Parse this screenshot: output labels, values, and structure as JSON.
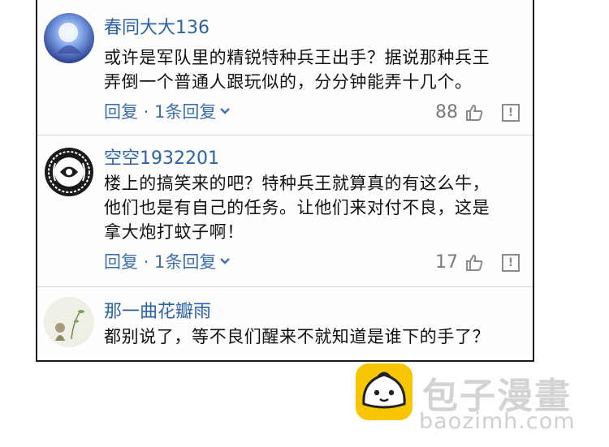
{
  "comments": [
    {
      "user": "春同大大136",
      "text_lines": [
        "或许是军队里的精锐特种兵王出手？据说那种兵王",
        "弄倒一个普通人跟玩似的，分分钟能弄十几个。"
      ],
      "reply_label": "回复 · 1条回复",
      "likes": "88"
    },
    {
      "user": "空空1932201",
      "text_lines": [
        "楼上的搞笑来的吧？特种兵王就算真的有这么牛，",
        "他们也是有自己的任务。让他们来对付不良，这是",
        "拿大炮打蚊子啊！"
      ],
      "reply_label": "回复 · 1条回复",
      "likes": "17"
    },
    {
      "user": "那一曲花瓣雨",
      "text_lines": [
        "都别说了，等不良们醒来不就知道是谁下的手了？"
      ]
    }
  ],
  "watermark": {
    "title": "包子漫畫",
    "url": "baozimh.com"
  },
  "colors": {
    "username": "#2b62a8",
    "reply": "#3d6fb0",
    "logo_yellow": "#f7c600"
  },
  "icons": [
    "thumbs-up-icon",
    "report-icon",
    "chevron-down-icon",
    "bun-logo-icon"
  ]
}
